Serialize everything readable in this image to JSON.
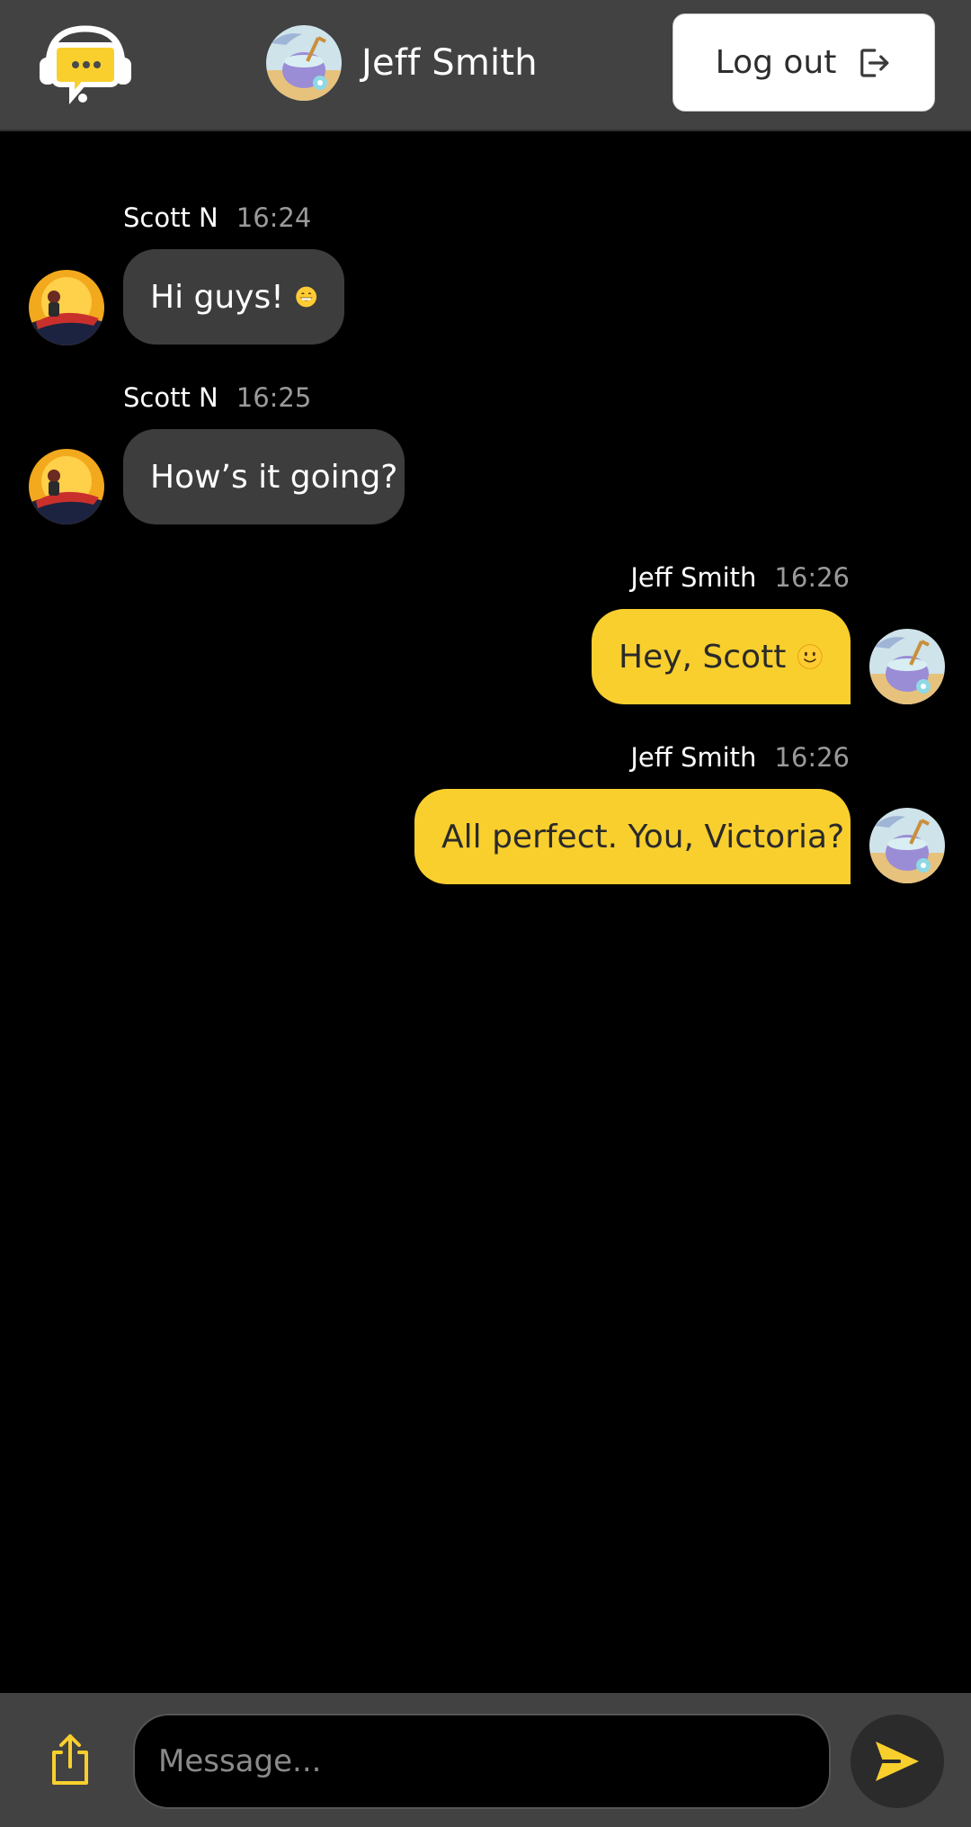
{
  "header": {
    "user_name": "Jeff Smith",
    "logout_label": "Log out",
    "logo_icon": "chat-headset-icon",
    "logout_icon": "logout-arrow-icon"
  },
  "messages": [
    {
      "sender": "Scott N",
      "time": "16:24",
      "text": "Hi guys!",
      "emoji": "grinning-face-icon",
      "direction": "incoming"
    },
    {
      "sender": "Scott N",
      "time": "16:25",
      "text": "How’s it going?",
      "direction": "incoming"
    },
    {
      "sender": "Jeff Smith",
      "time": "16:26",
      "text": "Hey, Scott",
      "emoji": "smiling-face-icon",
      "direction": "outgoing"
    },
    {
      "sender": "Jeff Smith",
      "time": "16:26",
      "text": "All perfect. You, Victoria?",
      "direction": "outgoing"
    }
  ],
  "composer": {
    "placeholder": "Message...",
    "upload_icon": "share-upload-icon",
    "send_icon": "send-arrow-icon"
  },
  "colors": {
    "accent": "#f9cf2e",
    "header_bg": "#424242",
    "incoming_bubble": "#3d3d3d",
    "background": "#000000"
  }
}
